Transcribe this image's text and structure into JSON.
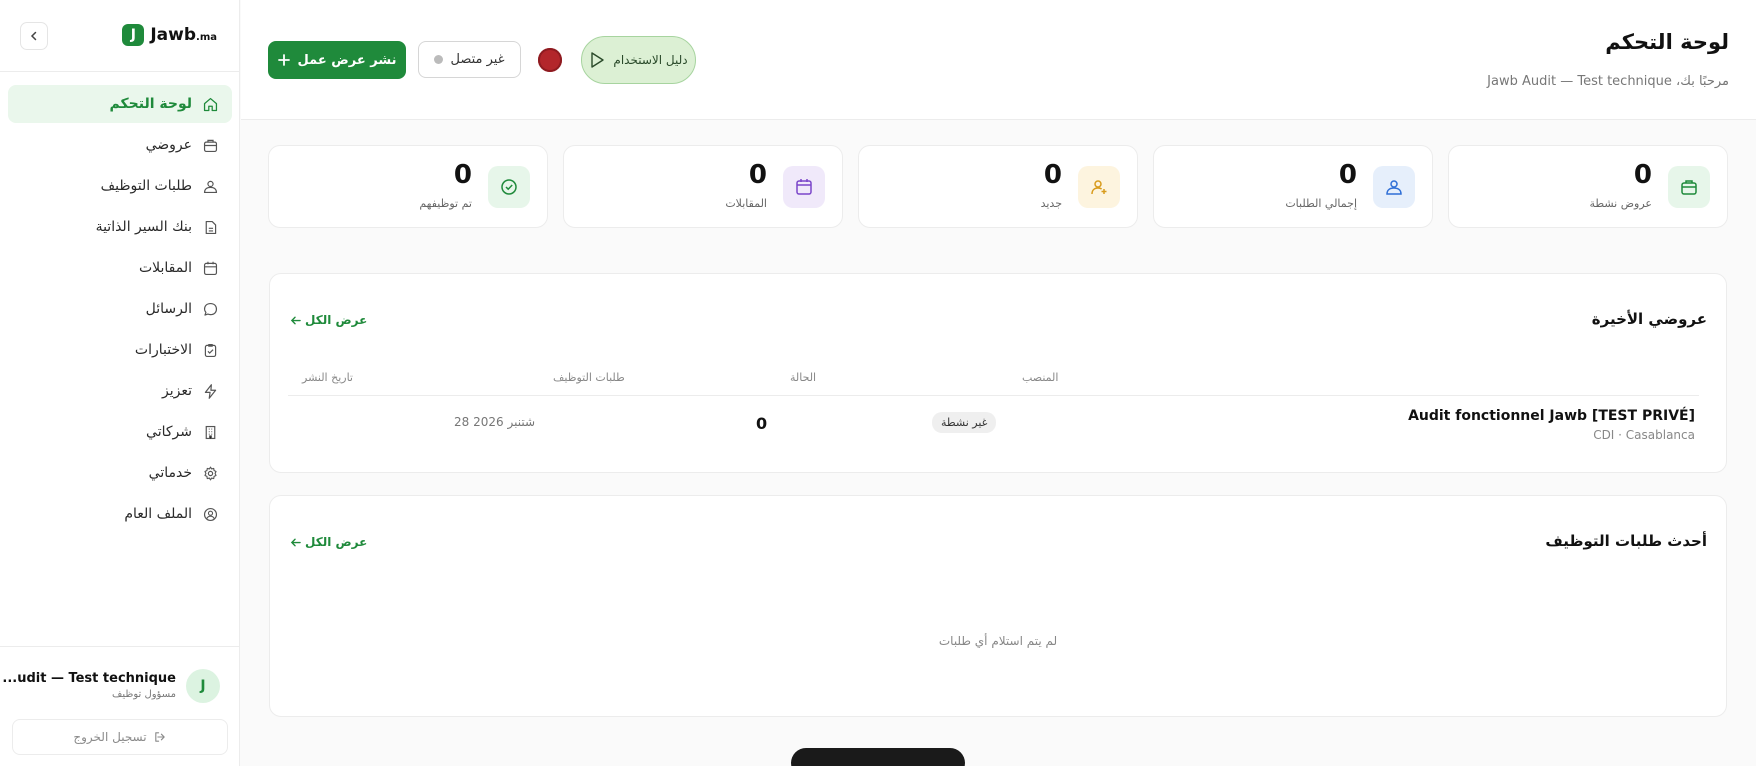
{
  "logo": {
    "mark": "J",
    "name": "Jawb",
    "suffix": ".ma"
  },
  "sidebar": {
    "items": [
      {
        "label": "لوحة التحكم",
        "icon": "home-icon",
        "active": true
      },
      {
        "label": "عروضي",
        "icon": "briefcase-icon"
      },
      {
        "label": "طلبات التوظيف",
        "icon": "users-icon"
      },
      {
        "label": "بنك السير الذاتية",
        "icon": "document-icon"
      },
      {
        "label": "المقابلات",
        "icon": "calendar-icon"
      },
      {
        "label": "الرسائل",
        "icon": "message-icon"
      },
      {
        "label": "الاختبارات",
        "icon": "clipboard-check-icon"
      },
      {
        "label": "تعزيز",
        "icon": "lightning-icon"
      },
      {
        "label": "شركاتي",
        "icon": "building-icon"
      },
      {
        "label": "خدماتي",
        "icon": "gear-icon"
      },
      {
        "label": "الملف العام",
        "icon": "user-circle-icon"
      }
    ],
    "user": {
      "initial": "J",
      "name": "...udit — Test technique",
      "role": "مسؤول توظيف"
    },
    "logout_label": "تسجيل الخروج"
  },
  "header": {
    "title": "لوحة التحكم",
    "welcome": "مرحبًا بك، Jawb Audit — Test technique",
    "publish_label": "نشر عرض عمل",
    "status_label": "غير متصل",
    "guide_label": "دليل الاستخدام"
  },
  "stats": [
    {
      "value": "0",
      "label": "عروض نشطة",
      "icon": "briefcase-icon",
      "color": "#1f8a3b",
      "bg": "#e7f6ea"
    },
    {
      "value": "0",
      "label": "إجمالي الطلبات",
      "icon": "users-icon",
      "color": "#2f6fd6",
      "bg": "#e6effb"
    },
    {
      "value": "0",
      "label": "جديد",
      "icon": "user-plus-icon",
      "color": "#d89b1c",
      "bg": "#fdf4df"
    },
    {
      "value": "0",
      "label": "المقابلات",
      "icon": "calendar-icon",
      "color": "#7a45c9",
      "bg": "#f0e9fa"
    },
    {
      "value": "0",
      "label": "تم توظيفهم",
      "icon": "check-circle-icon",
      "color": "#1f8a3b",
      "bg": "#e7f6ea"
    }
  ],
  "recent_offers": {
    "title": "عروضي الأخيرة",
    "view_all": "عرض الكل",
    "columns": {
      "position": "المنصب",
      "status": "الحالة",
      "applications": "طلبات التوظيف",
      "date": "تاريخ النشر"
    },
    "rows": [
      {
        "title": "Audit fonctionnel Jawb [TEST PRIVÉ]",
        "meta": "CDI · Casablanca",
        "status": "غير نشطة",
        "applications": "0",
        "date": "28 شتنبر 2026"
      }
    ]
  },
  "recent_applications": {
    "title": "أحدث طلبات التوظيف",
    "view_all": "عرض الكل",
    "empty": "لم يتم استلام أي طلبات"
  }
}
